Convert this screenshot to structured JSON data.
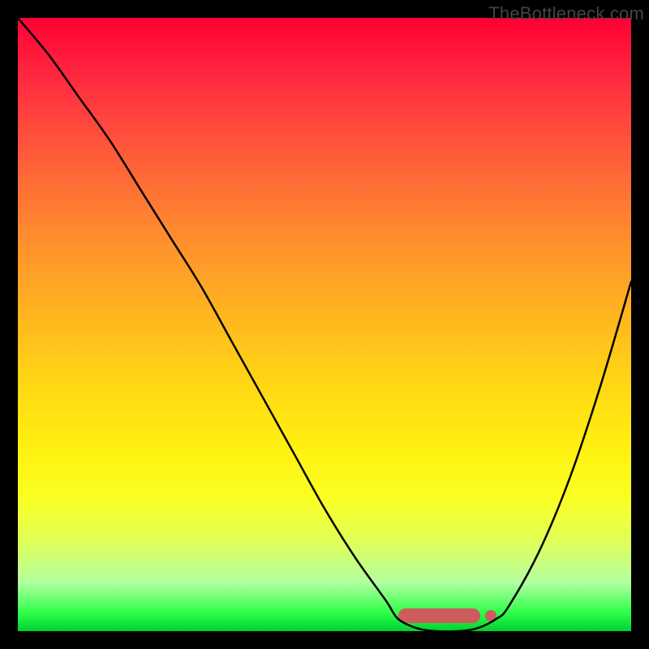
{
  "watermark": "TheBottleneck.com",
  "chart_data": {
    "type": "line",
    "title": "",
    "xlabel": "",
    "ylabel": "",
    "xlim": [
      0,
      100
    ],
    "ylim": [
      0,
      100
    ],
    "grid": false,
    "legend": false,
    "x": [
      0,
      5,
      10,
      15,
      20,
      25,
      30,
      35,
      40,
      45,
      50,
      55,
      60,
      62,
      65,
      68,
      72,
      75,
      78,
      80,
      85,
      90,
      95,
      100
    ],
    "y": [
      100,
      94,
      87,
      80,
      72,
      64,
      56,
      47,
      38,
      29,
      20,
      12,
      5,
      2,
      0.5,
      0,
      0,
      0.5,
      2,
      4,
      13,
      25,
      40,
      57
    ],
    "notes": "V-shaped bottleneck curve with flat minimum around x=65-75",
    "optimal_range": {
      "start_x": 62,
      "end_x": 78,
      "highlight_color": "#cd5c5c"
    },
    "background_gradient": {
      "type": "vertical",
      "stops": [
        {
          "pos": 0,
          "color": "#ff0033"
        },
        {
          "pos": 50,
          "color": "#ffcc15"
        },
        {
          "pos": 100,
          "color": "#00d030"
        }
      ]
    }
  }
}
